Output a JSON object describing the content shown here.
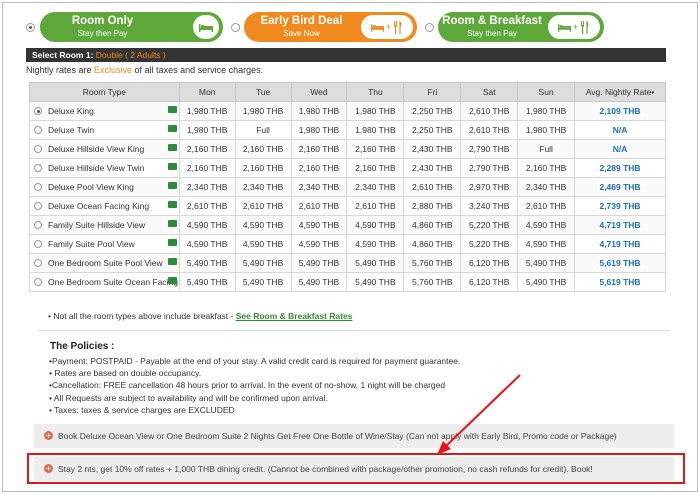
{
  "tabs": [
    {
      "title": "Room Only",
      "subtitle": "Stay then Pay",
      "icons": [
        "bed-icon"
      ],
      "color": "#5ea83a",
      "selected": true
    },
    {
      "title": "Early Bird Deal",
      "subtitle": "Save Now",
      "icons": [
        "bed-icon",
        "plus",
        "cutlery-icon"
      ],
      "color": "#f08a1e",
      "selected": false
    },
    {
      "title": "Room & Breakfast",
      "subtitle": "Stay then Pay",
      "icons": [
        "bed-icon",
        "plus",
        "cutlery-icon"
      ],
      "color": "#5ea83a",
      "selected": false
    }
  ],
  "select_room": {
    "prefix": "Select Room 1:",
    "detail": " Double ( 2 Adults )"
  },
  "notice": {
    "before": "Nightly rates are ",
    "highlight": "Exclusive",
    "after": " of all taxes and service charges."
  },
  "table": {
    "headers": [
      "Room Type",
      "Mon",
      "Tue",
      "Wed",
      "Thu",
      "Fri",
      "Sat",
      "Sun",
      "Avg. Nightly Rate•"
    ],
    "rows": [
      {
        "name": "Deluxe King",
        "selected": true,
        "rates": [
          "1,980 THB",
          "1,980 THB",
          "1,980 THB",
          "1,980 THB",
          "2,250 THB",
          "2,610 THB",
          "1,980 THB"
        ],
        "avg": "2,109 THB"
      },
      {
        "name": "Deluxe Twin",
        "selected": false,
        "rates": [
          "1,980 THB",
          "Full",
          "1,980 THB",
          "1,980 THB",
          "2,250 THB",
          "2,610 THB",
          "1,980 THB"
        ],
        "avg": "N/A"
      },
      {
        "name": "Deluxe Hillside View King",
        "selected": false,
        "rates": [
          "2,160 THB",
          "2,160 THB",
          "2,160 THB",
          "2,160 THB",
          "2,430 THB",
          "2,790 THB",
          "Full"
        ],
        "avg": "N/A"
      },
      {
        "name": "Deluxe Hillside View Twin",
        "selected": false,
        "rates": [
          "2,160 THB",
          "2,160 THB",
          "2,160 THB",
          "2,160 THB",
          "2,430 THB",
          "2,790 THB",
          "2,160 THB"
        ],
        "avg": "2,289 THB"
      },
      {
        "name": "Deluxe Pool View King",
        "selected": false,
        "rates": [
          "2,340 THB",
          "2,340 THB",
          "2,340 THB",
          "2,340 THB",
          "2,610 THB",
          "2,970 THB",
          "2,340 THB"
        ],
        "avg": "2,469 THB"
      },
      {
        "name": "Deluxe Ocean Facing King",
        "selected": false,
        "rates": [
          "2,610 THB",
          "2,610 THB",
          "2,610 THB",
          "2,610 THB",
          "2,880 THB",
          "3,240 THB",
          "2,610 THB"
        ],
        "avg": "2,739 THB"
      },
      {
        "name": "Family Suite Hillside View",
        "selected": false,
        "rates": [
          "4,590 THB",
          "4,590 THB",
          "4,590 THB",
          "4,590 THB",
          "4,860 THB",
          "5,220 THB",
          "4,590 THB"
        ],
        "avg": "4,719 THB"
      },
      {
        "name": "Family Suite Pool View",
        "selected": false,
        "rates": [
          "4,590 THB",
          "4,590 THB",
          "4,590 THB",
          "4,590 THB",
          "4,860 THB",
          "5,220 THB",
          "4,590 THB"
        ],
        "avg": "4,719 THB"
      },
      {
        "name": "One Bedroom Suite Pool View",
        "selected": false,
        "rates": [
          "5,490 THB",
          "5,490 THB",
          "5,490 THB",
          "5,490 THB",
          "5,760 THB",
          "6,120 THB",
          "5,490 THB"
        ],
        "avg": "5,619 THB"
      },
      {
        "name": "One Bedroom Suite Ocean Facing",
        "selected": false,
        "rates": [
          "5,490 THB",
          "5,490 THB",
          "5,490 THB",
          "5,490 THB",
          "5,760 THB",
          "6,120 THB",
          "5,490 THB"
        ],
        "avg": "5,619 THB"
      }
    ]
  },
  "note": {
    "text": "• Not all the room types above include breakfast  -  ",
    "link": "See Room & Breakfast Rates"
  },
  "policies": {
    "title": "The Policies :",
    "items": [
      "•Payment: POSTPAID - Payable at the end of your stay. A valid credit card is required for payment guarantee.",
      "• Rates are based on double occupancy.",
      "•Cancellation: FREE cancellation 48 hours prior to arrival. In the event of no-show, 1 night will be charged",
      "• All Requests are subject to availability and will be confirmed upon arrival.",
      "• Taxes: taxes & service charges are EXCLUDED"
    ]
  },
  "promos": [
    "Book Deluxe Ocean View or One Bedroom Suite 2 Nights Get Free One Bottle of Wine/Stay (Can not apply with Early Bird, Promo code or Package)",
    "Stay 2 nts, get 10% off rates + 1,000 THB dining credit. (Cannot be combined with package/other promotion, no cash refunds for credit). Book!"
  ],
  "colors": {
    "green": "#5ea83a",
    "orange": "#f08a1e",
    "link_blue": "#1a6fb5",
    "highlight_red": "#e8141a"
  }
}
